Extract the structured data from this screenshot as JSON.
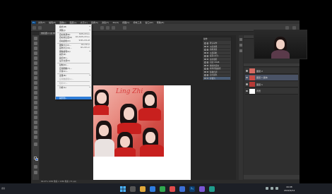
{
  "app": {
    "logo": "Ps",
    "menu": [
      "文件(F)",
      "编辑(E)",
      "图像(I)",
      "图层(L)",
      "文字(Y)",
      "选择(S)",
      "滤镜(T)",
      "3D(D)",
      "视图(V)",
      "增效工具",
      "窗口(W)",
      "帮助(H)"
    ],
    "doc_tab": "未标题-1 @ 66.7% (RGB/8#)"
  },
  "dropdown": {
    "items": [
      {
        "label": "模式(M)",
        "shortcut": "",
        "arrow": "▸",
        "state": "normal"
      },
      {
        "label": "调整(J)",
        "shortcut": "",
        "arrow": "▸",
        "state": "normal"
      },
      {
        "label": "自动色调(N)",
        "shortcut": "Shift+Ctrl+L",
        "arrow": "",
        "state": "normal"
      },
      {
        "label": "自动对比度(U)",
        "shortcut": "Alt+Shift+Ctrl+L",
        "arrow": "",
        "state": "normal"
      },
      {
        "label": "自动颜色(O)",
        "shortcut": "Shift+Ctrl+B",
        "arrow": "",
        "state": "normal"
      },
      {
        "label": "图像大小(I)...",
        "shortcut": "Alt+Ctrl+I",
        "arrow": "",
        "state": "normal"
      },
      {
        "label": "画布大小(S)...",
        "shortcut": "Alt+Ctrl+C",
        "arrow": "",
        "state": "normal"
      },
      {
        "label": "图像旋转(G)",
        "shortcut": "",
        "arrow": "▸",
        "state": "normal"
      },
      {
        "label": "裁剪(P)",
        "shortcut": "",
        "arrow": "",
        "state": "normal"
      },
      {
        "label": "裁切(R)...",
        "shortcut": "",
        "arrow": "",
        "state": "normal"
      },
      {
        "label": "显示全部(V)",
        "shortcut": "",
        "arrow": "",
        "state": "normal"
      },
      {
        "label": "复制(D)...",
        "shortcut": "",
        "arrow": "",
        "state": "normal"
      },
      {
        "label": "应用图像(Y)...",
        "shortcut": "",
        "arrow": "",
        "state": "normal"
      },
      {
        "label": "计算(C)...",
        "shortcut": "",
        "arrow": "",
        "state": "normal"
      },
      {
        "label": "变量(B)",
        "shortcut": "",
        "arrow": "▸",
        "state": "normal"
      },
      {
        "label": "应用数据组(L)...",
        "shortcut": "",
        "arrow": "",
        "state": "dim"
      },
      {
        "label": "陷印(T)...",
        "shortcut": "",
        "arrow": "",
        "state": "dim"
      },
      {
        "label": "分析(A)",
        "shortcut": "",
        "arrow": "▸",
        "state": "normal"
      },
      {
        "label": "裁剪到...",
        "shortcut": "",
        "arrow": "",
        "state": "active"
      }
    ]
  },
  "actions_panel": {
    "title": "动作",
    "rows": [
      "默认动作",
      "淡出效果",
      "画框通道",
      "木质画框",
      "投影(文字)",
      "水中倒影",
      "自定义RGB",
      "熔化的铅块",
      "制作剪贴路径",
      "棕褐色调",
      "四分颜色",
      "存储为",
      "渐变映射"
    ]
  },
  "layers": [
    {
      "name": "图层 2",
      "selected": false
    },
    {
      "name": "图层 1 副本",
      "selected": true
    },
    {
      "name": "图层 1",
      "selected": false
    },
    {
      "name": "背景",
      "selected": false
    }
  ],
  "artwork": {
    "script_text": "Ling Zhi"
  },
  "status_bar": {
    "text": "66.67%   1080 像素 x 1080 像素 (72 ppi)"
  },
  "taskbar": {
    "left_text": "搜索",
    "time": "16:08",
    "date": "2022/9/12"
  }
}
